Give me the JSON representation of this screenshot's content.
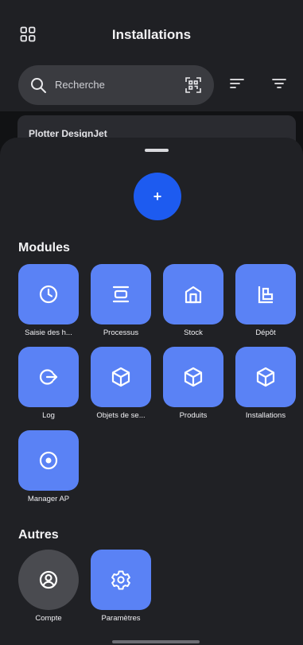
{
  "header": {
    "title": "Installations",
    "menu_icon": "grid-icon"
  },
  "search": {
    "placeholder": "Recherche",
    "scan_icon": "qr-scan-icon"
  },
  "toolbar": {
    "sort_icon": "sort-icon",
    "filter_icon": "filter-icon"
  },
  "list": {
    "partial_item_title": "Plotter DesignJet"
  },
  "sheet": {
    "fab_label": "+",
    "modules_title": "Modules",
    "modules": [
      {
        "label": "Saisie des h...",
        "icon": "clock-icon"
      },
      {
        "label": "Processus",
        "icon": "process-icon"
      },
      {
        "label": "Stock",
        "icon": "warehouse-icon"
      },
      {
        "label": "Dépôt",
        "icon": "depot-icon"
      },
      {
        "label": "Log",
        "icon": "logout-icon"
      },
      {
        "label": "Objets de se...",
        "icon": "cube-icon"
      },
      {
        "label": "Produits",
        "icon": "cube-icon"
      },
      {
        "label": "Installations",
        "icon": "cube-icon"
      },
      {
        "label": "Manager AP",
        "icon": "target-icon"
      }
    ],
    "others_title": "Autres",
    "others": [
      {
        "label": "Compte",
        "icon": "account-icon"
      },
      {
        "label": "Paramètres",
        "icon": "settings-icon"
      }
    ]
  },
  "colors": {
    "tile": "#5a82f5",
    "fab": "#1d5bf0",
    "sheet": "#202125",
    "topbar": "#1f2024"
  }
}
